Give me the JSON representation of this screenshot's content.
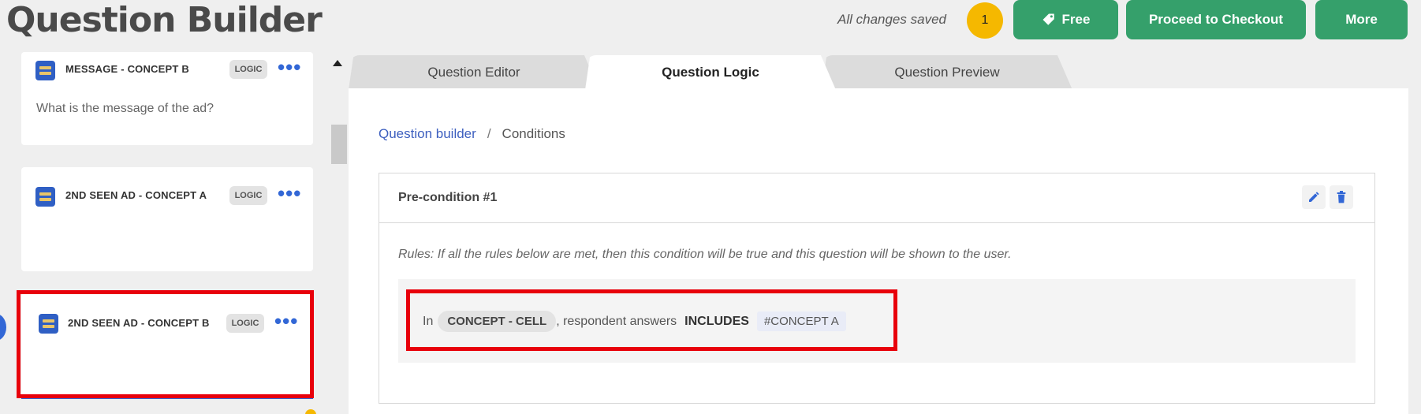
{
  "header": {
    "title": "Question Builder",
    "saved_status": "All changes saved",
    "notification_count": "1",
    "free_label": "Free",
    "checkout_label": "Proceed to Checkout",
    "more_label": "More"
  },
  "sidebar": {
    "logic_label": "LOGIC",
    "cards": [
      {
        "title": "MESSAGE - CONCEPT B",
        "text": "What is the message of the ad?"
      },
      {
        "title": "2ND SEEN AD - CONCEPT A",
        "text": ""
      },
      {
        "title": "2ND SEEN AD - CONCEPT B",
        "text": ""
      }
    ]
  },
  "tabs": [
    "Question Editor",
    "Question Logic",
    "Question Preview"
  ],
  "active_tab": "Question Logic",
  "breadcrumb": {
    "link": "Question builder",
    "separator": "/",
    "current": "Conditions"
  },
  "condition": {
    "title": "Pre-condition #1",
    "rules_text": "Rules: If all the rules below are met, then this condition will be true and this question will be shown to the user.",
    "rule": {
      "prefix": "In",
      "question": "CONCEPT - CELL",
      "middle": ", respondent answers",
      "operator": "INCLUDES",
      "value": "#CONCEPT A"
    }
  },
  "colors": {
    "brand_green": "#35a06b",
    "accent_blue": "#3267d6",
    "highlight_red": "#e8000b",
    "badge_yellow": "#f5b800"
  }
}
